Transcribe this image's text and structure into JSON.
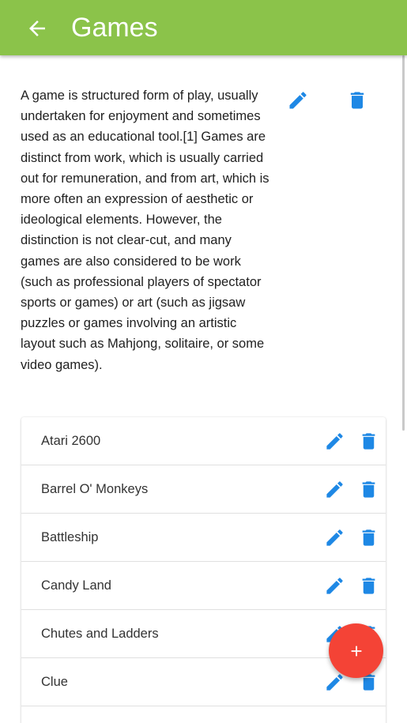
{
  "header": {
    "title": "Games",
    "back_icon": "arrow-back-icon",
    "background_color": "#8bc34a"
  },
  "description": {
    "text": "A game is structured form of play, usually undertaken for enjoyment and sometimes used as an educational tool.[1] Games are distinct from work, which is usually carried out for remuneration, and from art, which is more often an expression of aesthetic or ideological elements. However, the distinction is not clear-cut, and many games are also considered to be work (such as professional players of spectator sports or games) or art (such as jigsaw puzzles or games involving an artistic layout such as Mahjong, solitaire, or some video games).",
    "edit_icon": "pencil-icon",
    "delete_icon": "trash-icon"
  },
  "list": {
    "items": [
      {
        "label": "Atari 2600"
      },
      {
        "label": "Barrel O' Monkeys"
      },
      {
        "label": "Battleship"
      },
      {
        "label": "Candy Land"
      },
      {
        "label": "Chutes and Ladders"
      },
      {
        "label": "Clue"
      },
      {
        "label": ""
      }
    ],
    "edit_icon": "pencil-icon",
    "delete_icon": "trash-icon"
  },
  "fab": {
    "icon": "plus-icon",
    "color": "#f44336"
  },
  "colors": {
    "accent": "#1e88e5",
    "text": "#212121"
  }
}
